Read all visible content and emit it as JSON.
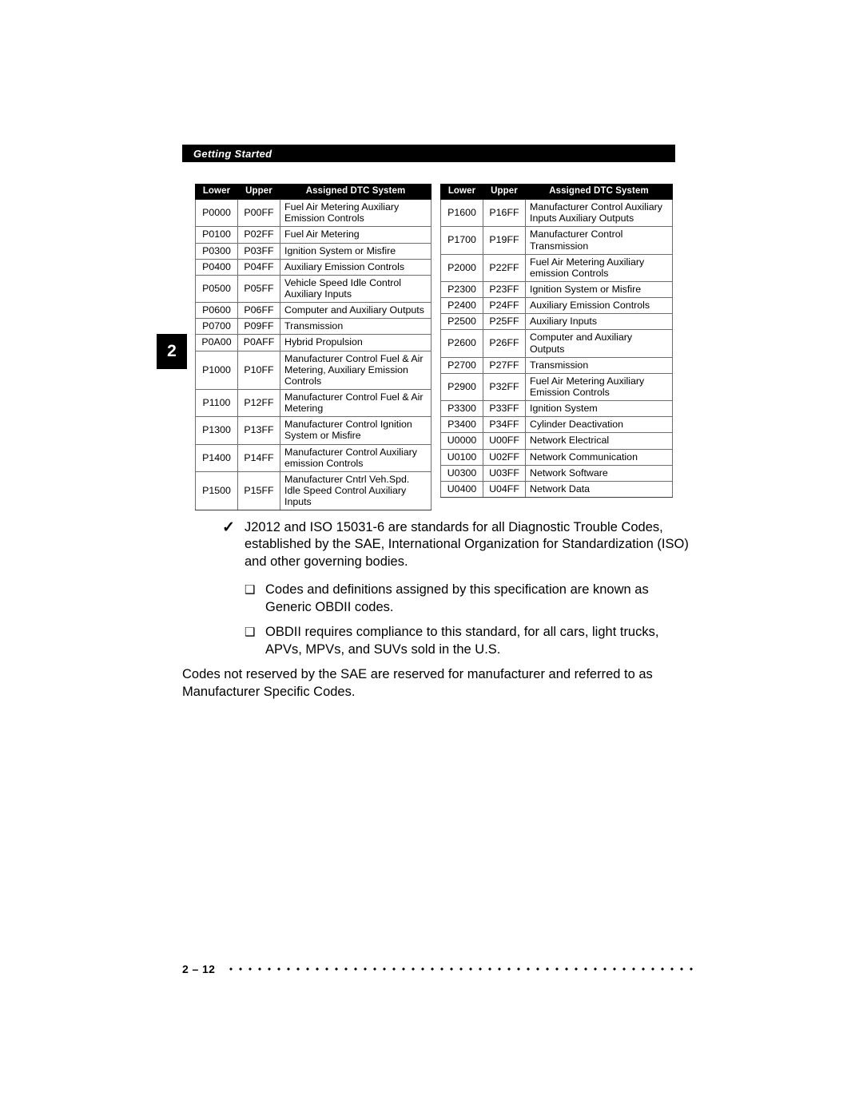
{
  "header": {
    "title": "Getting Started"
  },
  "chapter_tab": {
    "number": "2"
  },
  "tables": {
    "columns": {
      "lower": "Lower",
      "upper": "Upper",
      "system": "Assigned DTC System"
    },
    "left_rows": [
      {
        "lower": "P0000",
        "upper": "P00FF",
        "system": "Fuel Air Metering Auxiliary Emission Controls"
      },
      {
        "lower": "P0100",
        "upper": "P02FF",
        "system": "Fuel Air Metering"
      },
      {
        "lower": "P0300",
        "upper": "P03FF",
        "system": "Ignition System or Misfire"
      },
      {
        "lower": "P0400",
        "upper": "P04FF",
        "system": "Auxiliary Emission Controls"
      },
      {
        "lower": "P0500",
        "upper": "P05FF",
        "system": "Vehicle Speed Idle Control Auxiliary Inputs"
      },
      {
        "lower": "P0600",
        "upper": "P06FF",
        "system": "Computer and Auxiliary Outputs"
      },
      {
        "lower": "P0700",
        "upper": "P09FF",
        "system": "Transmission"
      },
      {
        "lower": "P0A00",
        "upper": "P0AFF",
        "system": "Hybrid Propulsion"
      },
      {
        "lower": "P1000",
        "upper": "P10FF",
        "system": "Manufacturer Control Fuel & Air Metering, Auxiliary Emission Controls"
      },
      {
        "lower": "P1100",
        "upper": "P12FF",
        "system": "Manufacturer Control Fuel & Air Metering"
      },
      {
        "lower": "P1300",
        "upper": "P13FF",
        "system": "Manufacturer Control Ignition System or Misfire"
      },
      {
        "lower": "P1400",
        "upper": "P14FF",
        "system": "Manufacturer Control Auxiliary emission Controls"
      },
      {
        "lower": "P1500",
        "upper": "P15FF",
        "system": "Manufacturer Cntrl Veh.Spd. Idle Speed Control Auxiliary Inputs"
      }
    ],
    "right_rows": [
      {
        "lower": "P1600",
        "upper": "P16FF",
        "system": "Manufacturer Control Auxiliary Inputs Auxiliary Outputs"
      },
      {
        "lower": "P1700",
        "upper": "P19FF",
        "system": "Manufacturer Control Transmission"
      },
      {
        "lower": "P2000",
        "upper": "P22FF",
        "system": "Fuel Air Metering Auxiliary emission Controls"
      },
      {
        "lower": "P2300",
        "upper": "P23FF",
        "system": "Ignition System or Misfire"
      },
      {
        "lower": "P2400",
        "upper": "P24FF",
        "system": "Auxiliary Emission Controls"
      },
      {
        "lower": "P2500",
        "upper": "P25FF",
        "system": "Auxiliary Inputs"
      },
      {
        "lower": "P2600",
        "upper": "P26FF",
        "system": "Computer and Auxiliary Outputs"
      },
      {
        "lower": "P2700",
        "upper": "P27FF",
        "system": "Transmission"
      },
      {
        "lower": "P2900",
        "upper": "P32FF",
        "system": "Fuel Air Metering Auxiliary Emission Controls"
      },
      {
        "lower": "P3300",
        "upper": "P33FF",
        "system": "Ignition System"
      },
      {
        "lower": "P3400",
        "upper": "P34FF",
        "system": "Cylinder Deactivation"
      },
      {
        "lower": "U0000",
        "upper": "U00FF",
        "system": "Network Electrical"
      },
      {
        "lower": "U0100",
        "upper": "U02FF",
        "system": "Network Communication"
      },
      {
        "lower": "U0300",
        "upper": "U03FF",
        "system": "Network Software"
      },
      {
        "lower": "U0400",
        "upper": "U04FF",
        "system": "Network Data"
      }
    ]
  },
  "body": {
    "check_glyph": "✓",
    "square_glyph": "❑",
    "bullet_1": "J2012 and ISO 15031-6 are standards for all Diagnostic Trouble Codes, established by the SAE, International Organization for Standardization (ISO) and other governing bodies.",
    "bullet_2": "Codes and definitions assigned by this specification are known as Generic OBDII codes.",
    "bullet_3": "OBDII requires compliance to this standard, for all cars, light trucks, APVs, MPVs, and SUVs sold in the U.S.",
    "paragraph": "Codes not reserved by the SAE are reserved for manufacturer and referred to as Manufacturer Specific Codes."
  },
  "footer": {
    "folio": "2 – 12"
  }
}
